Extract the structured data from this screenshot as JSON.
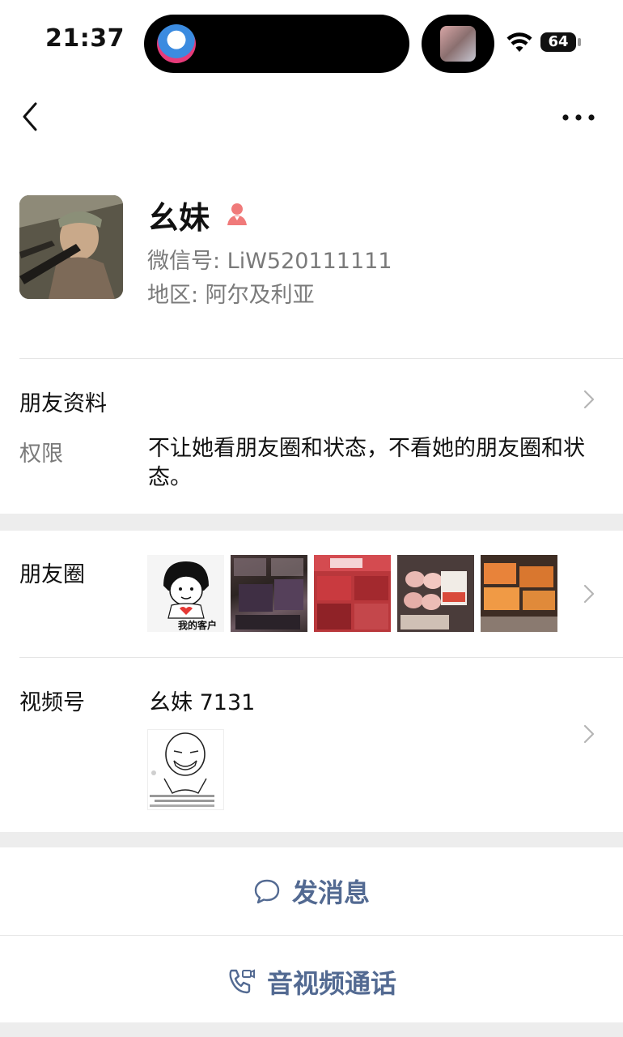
{
  "status_bar": {
    "time": "21:37",
    "battery": "64"
  },
  "nav": {
    "back_icon": "chevron-left-icon",
    "more_label": "•••"
  },
  "profile": {
    "name": "幺妹",
    "wechat_id": "微信号: LiW520111111",
    "region": "地区: 阿尔及利亚"
  },
  "friend_info": {
    "title": "朋友资料",
    "permission_label": "权限",
    "permission_text": "不让她看朋友圈和状态，不看她的朋友圈和状态。"
  },
  "moments": {
    "title": "朋友圈",
    "thumb1_caption": "我的客户"
  },
  "channels": {
    "title": "视频号",
    "name": "幺妹 7131"
  },
  "actions": {
    "message": "发消息",
    "call": "音视频通话"
  },
  "colors": {
    "accent": "#536a92",
    "gender_icon": "#f07a7a"
  }
}
